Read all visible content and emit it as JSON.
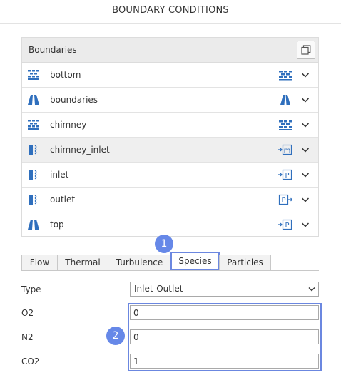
{
  "header": {
    "title": "BOUNDARY CONDITIONS"
  },
  "boundaries": {
    "label": "Boundaries",
    "copy_icon": "copy-icon",
    "items": [
      {
        "name": "bottom",
        "icon": "wall-icon",
        "type_icon": "wall-type-icon"
      },
      {
        "name": "boundaries",
        "icon": "symmetry-icon",
        "type_icon": "symmetry-type-icon"
      },
      {
        "name": "chimney",
        "icon": "wall-icon",
        "type_icon": "wall-type-icon"
      },
      {
        "name": "chimney_inlet",
        "icon": "inlet-icon",
        "type_icon": "mass-flow-inlet-icon",
        "type_letter": "m",
        "selected": true
      },
      {
        "name": "inlet",
        "icon": "inlet-icon",
        "type_icon": "pressure-inlet-icon",
        "type_letter": "P"
      },
      {
        "name": "outlet",
        "icon": "inlet-icon",
        "type_icon": "pressure-outlet-icon",
        "type_letter": "P"
      },
      {
        "name": "top",
        "icon": "symmetry-icon",
        "type_icon": "pressure-inlet-icon",
        "type_letter": "P"
      }
    ]
  },
  "callouts": {
    "one": "1",
    "two": "2"
  },
  "tabs": [
    {
      "label": "Flow"
    },
    {
      "label": "Thermal"
    },
    {
      "label": "Turbulence"
    },
    {
      "label": "Species",
      "active": true
    },
    {
      "label": "Particles"
    }
  ],
  "form": {
    "type_label": "Type",
    "type_value": "Inlet-Outlet",
    "fields": [
      {
        "label": "O2",
        "value": "0"
      },
      {
        "label": "N2",
        "value": "0"
      },
      {
        "label": "CO2",
        "value": "1"
      }
    ]
  },
  "colors": {
    "accent": "#6688e8",
    "icon_blue": "#2f6fbd",
    "highlight": "#6b87e0"
  }
}
